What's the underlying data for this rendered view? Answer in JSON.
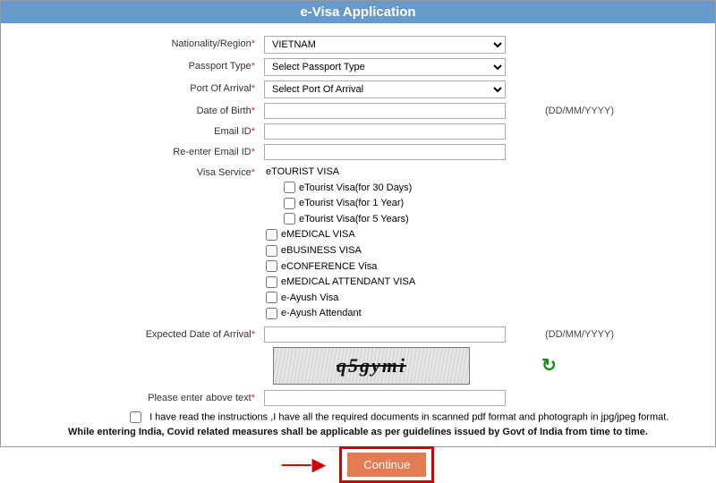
{
  "header": {
    "title": "e-Visa Application"
  },
  "labels": {
    "nationality": "Nationality/Region",
    "passport_type": "Passport Type",
    "port_of_arrival": "Port Of Arrival",
    "dob": "Date of Birth",
    "email": "Email ID",
    "reemail": "Re-enter Email ID",
    "visa_service": "Visa Service",
    "expected_arrival": "Expected Date of Arrival",
    "captcha_label": "Please enter above text"
  },
  "hints": {
    "date_format": "(DD/MM/YYYY)"
  },
  "fields": {
    "nationality_value": "VIETNAM",
    "passport_type_value": "Select Passport Type",
    "port_of_arrival_value": "Select Port Of Arrival",
    "dob_value": "",
    "email_value": "",
    "reemail_value": "",
    "expected_arrival_value": "",
    "captcha_input_value": ""
  },
  "visa": {
    "etourist": {
      "label": "eTOURIST VISA",
      "opts": {
        "d30": "eTourist Visa(for 30 Days)",
        "y1": "eTourist Visa(for 1 Year)",
        "y5": "eTourist Visa(for 5 Years)"
      }
    },
    "emedical": "eMEDICAL VISA",
    "ebusiness": "eBUSINESS VISA",
    "econference": "eCONFERENCE Visa",
    "emed_attendant": "eMEDICAL ATTENDANT VISA",
    "eayush": "e-Ayush Visa",
    "eayush_attendant": "e-Ayush Attendant"
  },
  "captcha": {
    "text": "q5gymi"
  },
  "consent": {
    "text": "I have read the instructions ,I have all the required documents in scanned pdf format and photograph in jpg/jpeg format."
  },
  "notice": {
    "text": "While entering India, Covid related measures shall be applicable as per guidelines issued by Govt of India from time to time."
  },
  "buttons": {
    "continue": "Continue"
  }
}
